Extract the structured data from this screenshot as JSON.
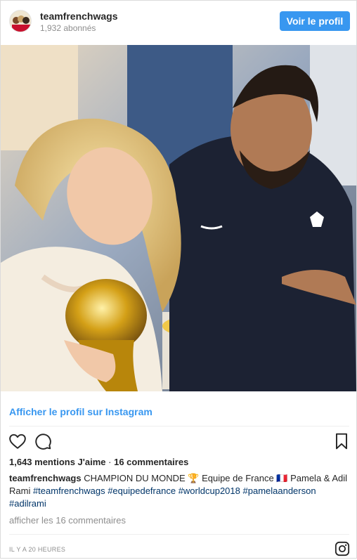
{
  "header": {
    "username": "teamfrenchwags",
    "followers": "1,932 abonnés",
    "profile_button": "Voir le profil"
  },
  "photo": {
    "alt_subject": "photo-two-people-with-world-cup-trophy"
  },
  "view_link": "Afficher le profil sur Instagram",
  "actions": {
    "like_icon": "heart-icon",
    "comment_icon": "comment-icon",
    "save_icon": "bookmark-icon"
  },
  "stats": {
    "likes": "1,643 mentions J'aime",
    "separator": "·",
    "comments": "16 commentaires"
  },
  "caption": {
    "username": "teamfrenchwags",
    "text": " CHAMPION DU MONDE 🏆 Equipe de France 🇫🇷 Pamela & Adil Rami ",
    "hashtags": [
      "#teamfrenchwags",
      "#equipedefrance",
      "#worldcup2018",
      "#pamelaanderson",
      "#adilrami"
    ]
  },
  "view_comments": "afficher les 16 commentaires",
  "timestamp": "IL Y A 20 HEURES",
  "colors": {
    "accent": "#3897f0",
    "hashtag": "#003569",
    "muted": "#8e8e8e"
  }
}
